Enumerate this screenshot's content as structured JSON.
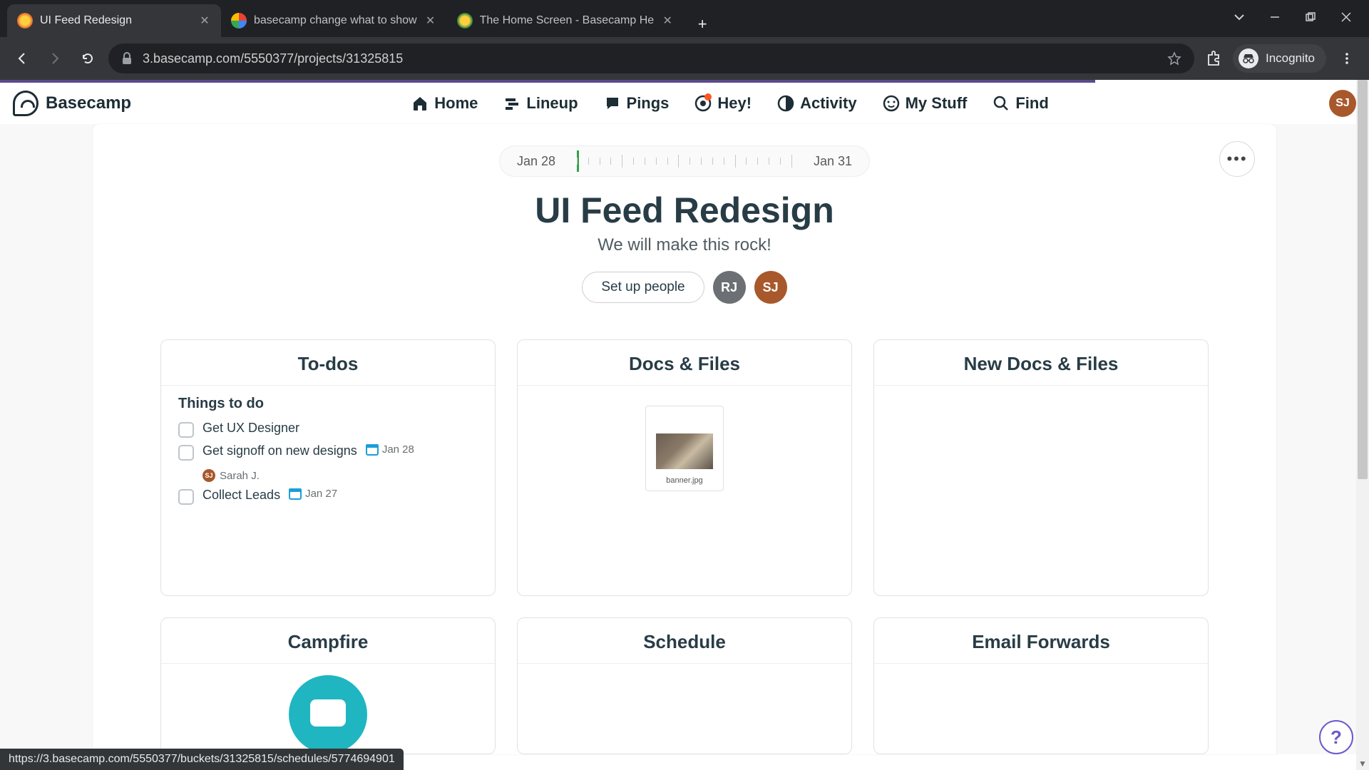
{
  "browser": {
    "tabs": [
      {
        "title": "UI Feed Redesign",
        "active": true
      },
      {
        "title": "basecamp change what to show",
        "active": false
      },
      {
        "title": "The Home Screen - Basecamp He",
        "active": false
      }
    ],
    "url": "3.basecamp.com/5550377/projects/31325815",
    "incognito_label": "Incognito"
  },
  "nav": {
    "logo": "Basecamp",
    "items": [
      {
        "label": "Home"
      },
      {
        "label": "Lineup"
      },
      {
        "label": "Pings"
      },
      {
        "label": "Hey!",
        "badge": true
      },
      {
        "label": "Activity"
      },
      {
        "label": "My Stuff"
      },
      {
        "label": "Find"
      }
    ],
    "avatar": "SJ"
  },
  "timeline": {
    "start": "Jan 28",
    "end": "Jan 31"
  },
  "project": {
    "title": "UI Feed Redesign",
    "tagline": "We will make this rock!",
    "setup_people": "Set up people",
    "people": [
      {
        "initials": "RJ",
        "cls": "av-rj"
      },
      {
        "initials": "SJ",
        "cls": "av-sj"
      }
    ]
  },
  "cards": {
    "todos": {
      "title": "To-dos",
      "list_title": "Things to do",
      "items": [
        {
          "text": "Get UX Designer"
        },
        {
          "text": "Get signoff on new designs",
          "date": "Jan 28",
          "assignee": "Sarah J.",
          "assignee_initials": "SJ"
        },
        {
          "text": "Collect Leads",
          "date": "Jan 27"
        }
      ]
    },
    "docs": {
      "title": "Docs & Files",
      "file": "banner.jpg"
    },
    "newdocs": {
      "title": "New Docs & Files"
    },
    "campfire": {
      "title": "Campfire"
    },
    "schedule": {
      "title": "Schedule"
    },
    "email": {
      "title": "Email Forwards"
    }
  },
  "status_url": "https://3.basecamp.com/5550377/buckets/31325815/schedules/5774694901"
}
